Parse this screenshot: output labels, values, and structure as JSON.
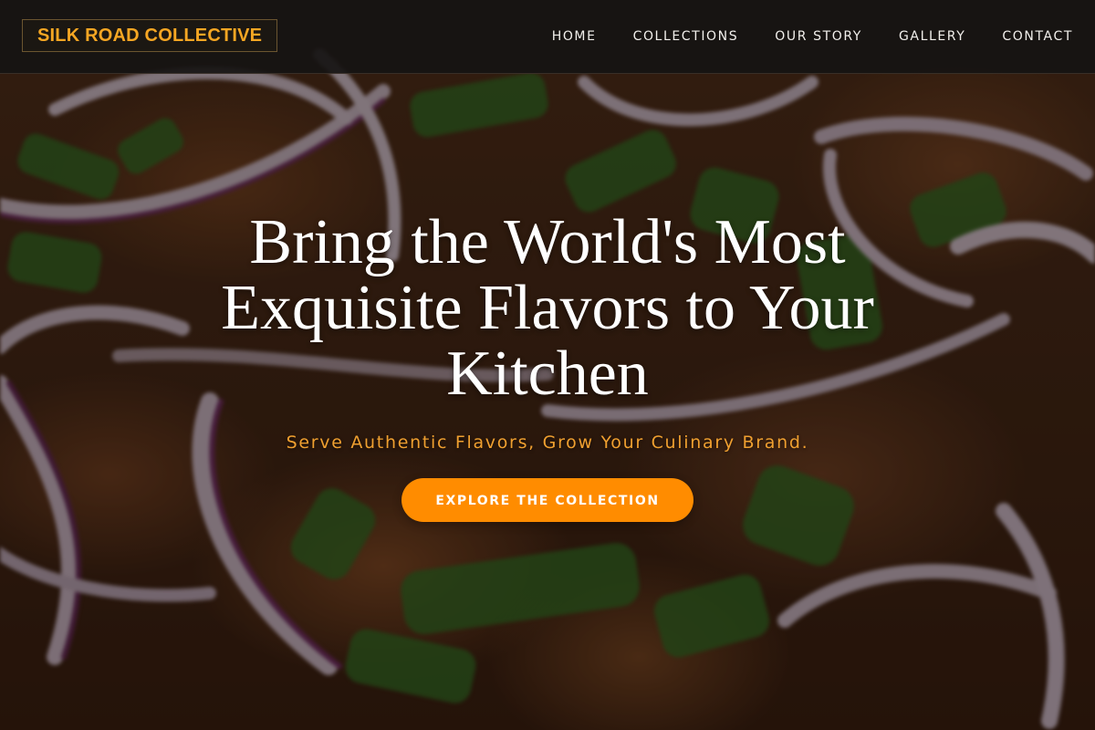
{
  "brand": {
    "name": "SILK ROAD COLLECTIVE",
    "accent_color": "#f5a623"
  },
  "nav": {
    "items": [
      {
        "label": "HOME"
      },
      {
        "label": "COLLECTIONS"
      },
      {
        "label": "OUR STORY"
      },
      {
        "label": "GALLERY"
      },
      {
        "label": "CONTACT"
      }
    ]
  },
  "hero": {
    "title": "Bring the World's Most Exquisite Flavors to Your Kitchen",
    "subtitle": "Serve Authentic Flavors, Grow Your Culinary Brand.",
    "cta_label": "EXPLORE THE COLLECTION",
    "cta_color": "#ff8c00",
    "subtitle_color": "#f0a030"
  }
}
